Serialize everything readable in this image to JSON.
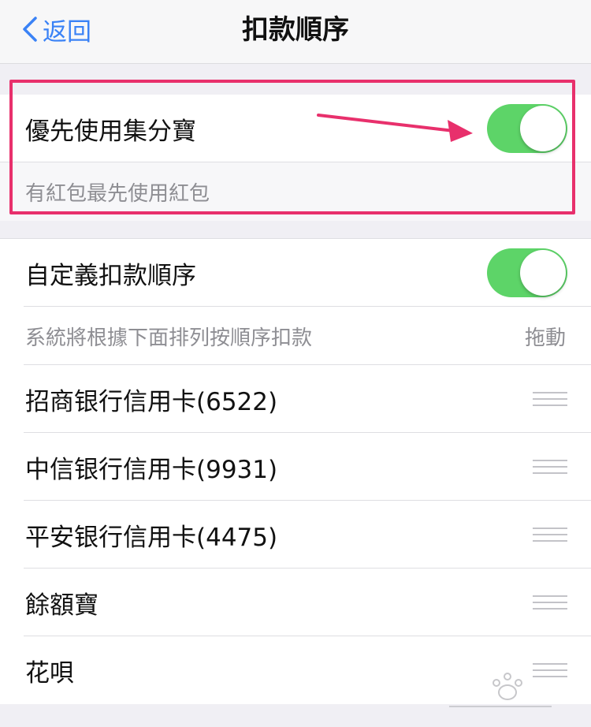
{
  "navbar": {
    "back_label": "返回",
    "title": "扣款順序"
  },
  "points_section": {
    "toggle_label": "優先使用集分寶",
    "toggle_on": true,
    "note": "有紅包最先使用紅包"
  },
  "custom_section": {
    "toggle_label": "自定義扣款順序",
    "toggle_on": true,
    "hint": "系統將根據下面排列按順序扣款",
    "drag_label": "拖動"
  },
  "payment_methods": [
    {
      "name": "招商银行信用卡(6522)"
    },
    {
      "name": "中信银行信用卡(9931)"
    },
    {
      "name": "平安银行信用卡(4475)"
    },
    {
      "name": "餘額寶"
    },
    {
      "name": "花唄"
    }
  ],
  "colors": {
    "accent": "#3a82f6",
    "toggle_on": "#5dd468",
    "highlight": "#e8306c"
  },
  "icons": {
    "back": "chevron-left-icon",
    "drag": "drag-handle-icon",
    "annotation": "annotation-arrow-icon"
  }
}
